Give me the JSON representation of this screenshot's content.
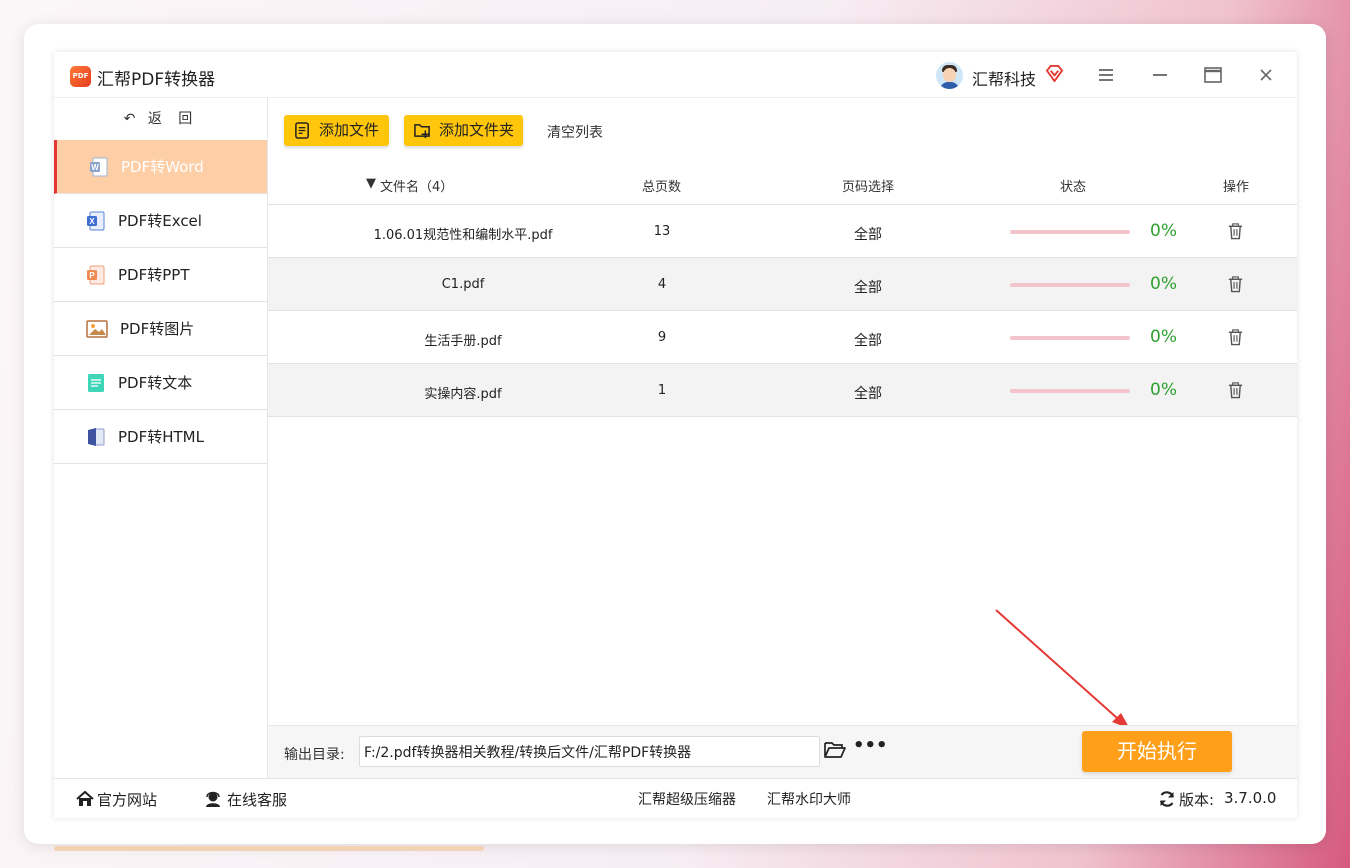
{
  "app": {
    "logo_text": "PDF",
    "title": "汇帮PDF转换器",
    "user_name": "汇帮科技"
  },
  "sidebar": {
    "back_label": "返 回",
    "items": [
      {
        "label": "PDF转Word",
        "active": true,
        "icon": "word-icon"
      },
      {
        "label": "PDF转Excel",
        "active": false,
        "icon": "excel-icon"
      },
      {
        "label": "PDF转PPT",
        "active": false,
        "icon": "ppt-icon"
      },
      {
        "label": "PDF转图片",
        "active": false,
        "icon": "image-icon"
      },
      {
        "label": "PDF转文本",
        "active": false,
        "icon": "text-icon"
      },
      {
        "label": "PDF转HTML",
        "active": false,
        "icon": "html-icon"
      }
    ]
  },
  "toolbar": {
    "add_file": "添加文件",
    "add_folder": "添加文件夹",
    "clear_list": "清空列表"
  },
  "table": {
    "headers": {
      "name": "文件名（4）",
      "pages": "总页数",
      "range": "页码选择",
      "status": "状态",
      "action": "操作"
    },
    "rows": [
      {
        "name": "1.06.01规范性和编制水平.pdf",
        "pages": "13",
        "range": "全部",
        "progress": 0,
        "percent": "0%"
      },
      {
        "name": "C1.pdf",
        "pages": "4",
        "range": "全部",
        "progress": 0,
        "percent": "0%"
      },
      {
        "name": "生活手册.pdf",
        "pages": "9",
        "range": "全部",
        "progress": 0,
        "percent": "0%"
      },
      {
        "name": "实操内容.pdf",
        "pages": "1",
        "range": "全部",
        "progress": 0,
        "percent": "0%"
      }
    ]
  },
  "output": {
    "label": "输出目录:",
    "path": "F:/2.pdf转换器相关教程/转换后文件/汇帮PDF转换器",
    "start_label": "开始执行"
  },
  "footer": {
    "website": "官方网站",
    "support": "在线客服",
    "compressor": "汇帮超级压缩器",
    "watermark": "汇帮水印大师",
    "version_label": "版本:",
    "version": "3.7.0.0"
  },
  "colors": {
    "accent_yellow": "#ffc60b",
    "start_orange": "#ff9f1a",
    "active_item": "#fecea7",
    "percent_green": "#2ea02e",
    "arrow_red": "#e53935"
  }
}
